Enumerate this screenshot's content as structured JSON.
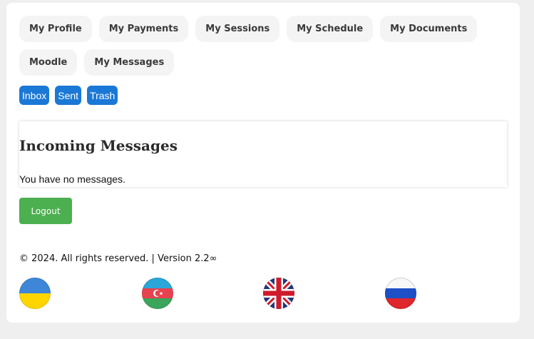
{
  "nav": {
    "items": [
      {
        "id": "my-profile",
        "label": "My Profile"
      },
      {
        "id": "my-payments",
        "label": "My Payments"
      },
      {
        "id": "my-sessions",
        "label": "My Sessions"
      },
      {
        "id": "my-schedule",
        "label": "My Schedule"
      },
      {
        "id": "my-documents",
        "label": "My Documents"
      },
      {
        "id": "moodle",
        "label": "Moodle"
      },
      {
        "id": "my-messages",
        "label": "My Messages"
      }
    ]
  },
  "message_tabs": {
    "inbox": "Inbox",
    "sent": "Sent",
    "trash": "Trash"
  },
  "messages_panel": {
    "title": "Incoming Messages",
    "empty_text": "You have no messages."
  },
  "logout_label": "Logout",
  "footer": {
    "text": "© 2024. All rights reserved.  | Version 2.2∞"
  },
  "languages": [
    {
      "id": "ua",
      "icon": "ukraine-flag-icon"
    },
    {
      "id": "az",
      "icon": "azerbaijan-flag-icon"
    },
    {
      "id": "uk",
      "icon": "united-kingdom-flag-icon"
    },
    {
      "id": "ru",
      "icon": "russia-flag-icon"
    }
  ],
  "colors": {
    "tab_blue": "#1a78d6",
    "logout_green": "#4caf50",
    "nav_button_bg": "#f4f4f4",
    "page_bg": "#efefef"
  }
}
